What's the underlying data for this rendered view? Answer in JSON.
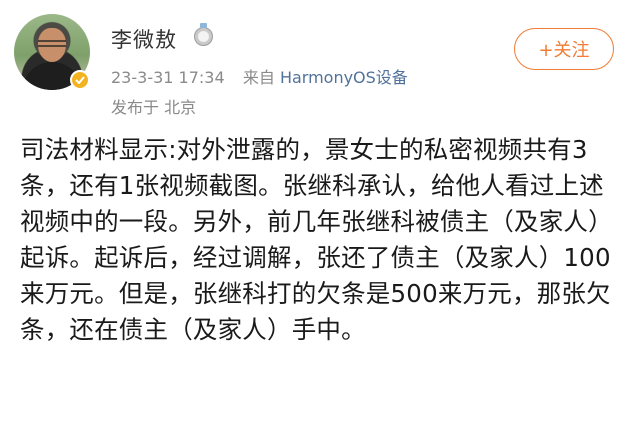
{
  "post": {
    "author_name": "李微敖",
    "timestamp": "23-3-31 17:34",
    "source_prefix": "来自",
    "device": "HarmonyOS设备",
    "location": "发布于 北京",
    "follow_label": "+关注",
    "content": "司法材料显示:对外泄露的，景女士的私密视频共有3条，还有1张视频截图。张继科承认，给他人看过上述视频中的一段。另外，前几年张继科被债主（及家人）起诉。起诉后，经过调解，张还了债主（及家人）100来万元。但是，张继科打的欠条是500来万元，那张欠条，还在债主（及家人）手中。"
  },
  "colors": {
    "accent_orange": "#f07c35",
    "verified_gold": "#f3b321",
    "link_blue": "#51729a",
    "meta_gray": "#8a8a8a"
  },
  "icons": {
    "verified": "verified-badge-icon",
    "medal": "medal-icon"
  }
}
